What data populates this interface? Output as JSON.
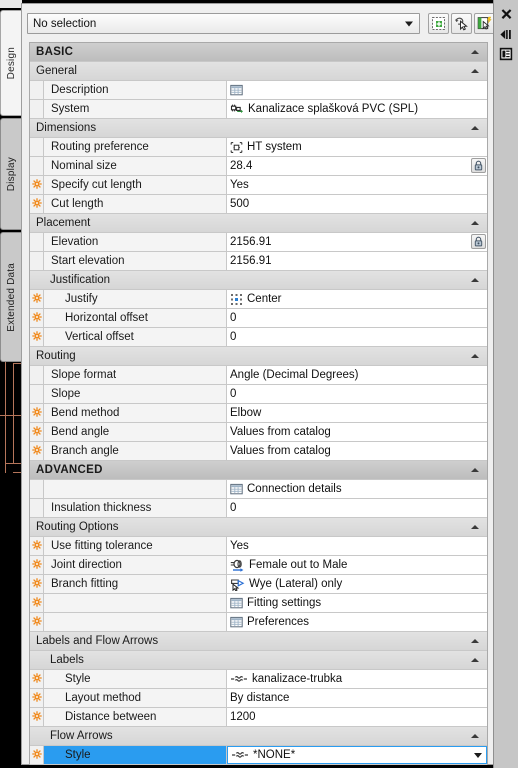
{
  "window": {
    "gutter_buttons": [
      {
        "name": "close-icon",
        "label": "Close"
      },
      {
        "name": "auto-hide-icon",
        "label": "Auto-hide"
      },
      {
        "name": "panel-menu-icon",
        "label": "Properties"
      }
    ]
  },
  "tabs": [
    {
      "label": "Design",
      "active": true
    },
    {
      "label": "Display",
      "active": false
    },
    {
      "label": "Extended Data",
      "active": false
    }
  ],
  "selection": {
    "value": "No selection",
    "buttons": [
      {
        "name": "select-objects-button",
        "title": "Select objects"
      },
      {
        "name": "quick-select-button",
        "title": "Quick select"
      },
      {
        "name": "quick-properties-button",
        "title": "Quick properties"
      }
    ]
  },
  "grid": {
    "rows": [
      {
        "kind": "cat0",
        "label": "BASIC",
        "collapsed": false
      },
      {
        "kind": "cat1",
        "label": "General",
        "collapsed": false
      },
      {
        "kind": "prop",
        "indent": 1,
        "star": false,
        "label": "Description",
        "value": "",
        "icon": "table-icon",
        "lock": false
      },
      {
        "kind": "prop",
        "indent": 1,
        "star": false,
        "label": "System",
        "value": "Kanalizace splašková PVC (SPL)",
        "icon": "system-icon",
        "lock": false
      },
      {
        "kind": "cat1",
        "label": "Dimensions",
        "collapsed": false
      },
      {
        "kind": "prop",
        "indent": 1,
        "star": false,
        "label": "Routing preference",
        "value": "HT system",
        "icon": "routing-pref-icon",
        "lock": false
      },
      {
        "kind": "prop",
        "indent": 1,
        "star": false,
        "label": "Nominal size",
        "value": "28.4",
        "icon": null,
        "lock": true
      },
      {
        "kind": "prop",
        "indent": 1,
        "star": true,
        "label": "Specify cut length",
        "value": "Yes",
        "icon": null,
        "lock": false
      },
      {
        "kind": "prop",
        "indent": 1,
        "star": true,
        "label": "Cut length",
        "value": "500",
        "icon": null,
        "lock": false
      },
      {
        "kind": "cat1",
        "label": "Placement",
        "collapsed": false
      },
      {
        "kind": "prop",
        "indent": 1,
        "star": false,
        "label": "Elevation",
        "value": "2156.91",
        "icon": null,
        "lock": true
      },
      {
        "kind": "prop",
        "indent": 1,
        "star": false,
        "label": "Start elevation",
        "value": "2156.91",
        "icon": null,
        "lock": false
      },
      {
        "kind": "cat2",
        "label": "Justification",
        "collapsed": false
      },
      {
        "kind": "prop",
        "indent": 2,
        "star": true,
        "label": "Justify",
        "value": "Center",
        "icon": "justify-icon",
        "lock": false
      },
      {
        "kind": "prop",
        "indent": 2,
        "star": true,
        "label": "Horizontal offset",
        "value": "0",
        "icon": null,
        "lock": false
      },
      {
        "kind": "prop",
        "indent": 2,
        "star": true,
        "label": "Vertical offset",
        "value": "0",
        "icon": null,
        "lock": false
      },
      {
        "kind": "cat1",
        "label": "Routing",
        "collapsed": false
      },
      {
        "kind": "prop",
        "indent": 1,
        "star": false,
        "label": "Slope format",
        "value": "Angle (Decimal Degrees)",
        "icon": null,
        "lock": false
      },
      {
        "kind": "prop",
        "indent": 1,
        "star": false,
        "label": "Slope",
        "value": "0",
        "icon": null,
        "lock": false
      },
      {
        "kind": "prop",
        "indent": 1,
        "star": true,
        "label": "Bend method",
        "value": "Elbow",
        "icon": null,
        "lock": false
      },
      {
        "kind": "prop",
        "indent": 1,
        "star": true,
        "label": "Bend angle",
        "value": "Values from catalog",
        "icon": null,
        "lock": false
      },
      {
        "kind": "prop",
        "indent": 1,
        "star": true,
        "label": "Branch angle",
        "value": "Values from catalog",
        "icon": null,
        "lock": false
      },
      {
        "kind": "cat0",
        "label": "ADVANCED",
        "collapsed": false
      },
      {
        "kind": "prop",
        "indent": 1,
        "star": false,
        "label": "",
        "value": "Connection details",
        "icon": "table-icon",
        "lock": false
      },
      {
        "kind": "prop",
        "indent": 1,
        "star": false,
        "label": "Insulation thickness",
        "value": "0",
        "icon": null,
        "lock": false
      },
      {
        "kind": "cat1",
        "label": "Routing Options",
        "collapsed": false
      },
      {
        "kind": "prop",
        "indent": 1,
        "star": true,
        "label": "Use fitting tolerance",
        "value": "Yes",
        "icon": null,
        "lock": false
      },
      {
        "kind": "prop",
        "indent": 1,
        "star": true,
        "label": "Joint direction",
        "value": "Female out to Male",
        "icon": "joint-direction-icon",
        "lock": false
      },
      {
        "kind": "prop",
        "indent": 1,
        "star": true,
        "label": "Branch fitting",
        "value": "Wye (Lateral) only",
        "icon": "branch-fitting-icon",
        "lock": false
      },
      {
        "kind": "prop",
        "indent": 1,
        "star": true,
        "label": "",
        "value": "Fitting settings",
        "icon": "table-icon",
        "lock": false
      },
      {
        "kind": "prop",
        "indent": 1,
        "star": true,
        "label": "",
        "value": "Preferences",
        "icon": "table-icon",
        "lock": false
      },
      {
        "kind": "cat1",
        "label": "Labels and Flow Arrows",
        "collapsed": false
      },
      {
        "kind": "cat2",
        "label": "Labels",
        "collapsed": false
      },
      {
        "kind": "prop",
        "indent": 2,
        "star": true,
        "label": "Style",
        "value": "kanalizace-trubka",
        "icon": "label-style-icon",
        "lock": false
      },
      {
        "kind": "prop",
        "indent": 2,
        "star": true,
        "label": "Layout method",
        "value": "By distance",
        "icon": null,
        "lock": false
      },
      {
        "kind": "prop",
        "indent": 2,
        "star": true,
        "label": "Distance between",
        "value": "1200",
        "icon": null,
        "lock": false
      },
      {
        "kind": "cat2",
        "label": "Flow Arrows",
        "collapsed": false
      },
      {
        "kind": "prop",
        "indent": 2,
        "star": true,
        "label": "Style",
        "value": "*NONE*",
        "icon": "label-style-icon",
        "lock": false,
        "selected": true,
        "dropdown": true
      }
    ]
  },
  "colors": {
    "accent_selection": "#2a9cf0",
    "star_orange": "#f08a1e",
    "category_header": "#c4c4c4",
    "canvas": "#000000",
    "drawing_line": "#b5755a"
  }
}
